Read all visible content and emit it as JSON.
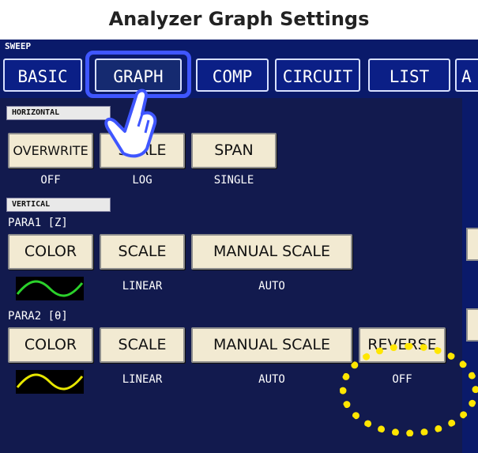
{
  "header": {
    "title": "Analyzer Graph Settings"
  },
  "sweep_label": "SWEEP",
  "tabs": [
    {
      "label": "BASIC"
    },
    {
      "label": "GRAPH"
    },
    {
      "label": "COMP"
    },
    {
      "label": "CIRCUIT"
    },
    {
      "label": "LIST"
    },
    {
      "label": "A"
    }
  ],
  "horizontal": {
    "section_label": "HORIZONTAL",
    "buttons": [
      {
        "label": "OVERWRITE",
        "value": "OFF"
      },
      {
        "label": "SCALE",
        "value": "LOG"
      },
      {
        "label": "SPAN",
        "value": "SINGLE"
      }
    ]
  },
  "vertical": {
    "section_label": "VERTICAL",
    "para1": {
      "label": "PARA1 [Z]",
      "color_label": "COLOR",
      "scale_label": "SCALE",
      "scale_value": "LINEAR",
      "manual_label": "MANUAL SCALE",
      "manual_value": "AUTO",
      "wave_color": "#2bd12b"
    },
    "para2": {
      "label": "PARA2 [θ]",
      "color_label": "COLOR",
      "scale_label": "SCALE",
      "scale_value": "LINEAR",
      "manual_label": "MANUAL SCALE",
      "manual_value": "AUTO",
      "reverse_label": "REVERSE",
      "reverse_value": "OFF",
      "wave_color": "#e6e600"
    }
  },
  "colors": {
    "accent": "#3f56ff",
    "highlight_dots": "#ffe600",
    "button_bg": "#f2ead2"
  }
}
